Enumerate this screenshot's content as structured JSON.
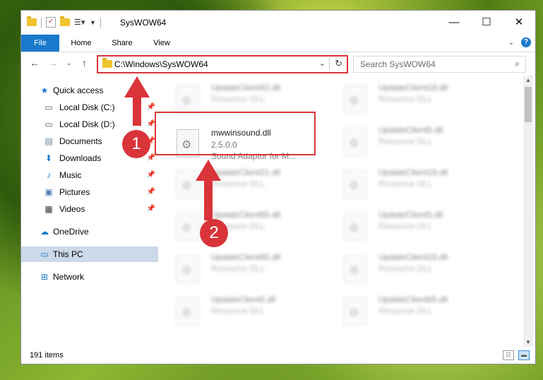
{
  "window": {
    "title": "SysWOW64"
  },
  "ribbon": {
    "tabs": [
      "File",
      "Home",
      "Share",
      "View"
    ]
  },
  "address": {
    "path": "C:\\Windows\\SysWOW64"
  },
  "search": {
    "placeholder": "Search SysWOW64"
  },
  "sidebar": {
    "items": [
      {
        "label": "Quick access",
        "icon": "star-icon"
      },
      {
        "label": "Local Disk (C:)",
        "icon": "drive-icon",
        "pinned": true
      },
      {
        "label": "Local Disk (D:)",
        "icon": "drive-icon",
        "pinned": true
      },
      {
        "label": "Documents",
        "icon": "documents-icon",
        "pinned": true
      },
      {
        "label": "Downloads",
        "icon": "download-icon",
        "pinned": true
      },
      {
        "label": "Music",
        "icon": "music-icon",
        "pinned": true
      },
      {
        "label": "Pictures",
        "icon": "pictures-icon",
        "pinned": true
      },
      {
        "label": "Videos",
        "icon": "videos-icon",
        "pinned": true
      },
      {
        "label": "OneDrive",
        "icon": "cloud-icon"
      },
      {
        "label": "This PC",
        "icon": "computer-icon",
        "selected": true
      },
      {
        "label": "Network",
        "icon": "network-icon"
      }
    ]
  },
  "files": {
    "left": [
      {
        "name": "UpdateClient42.dll",
        "desc": "Resource DLL"
      },
      {
        "name": "UpdateClient21.dll",
        "desc": "Resource DLL"
      },
      {
        "name": "UpdateClient65.dll",
        "desc": "Resource DLL"
      },
      {
        "name": "UpdateClient65.dll",
        "desc": "Resource DLL"
      },
      {
        "name": "UpdateClient5.dll",
        "desc": "Resource DLL"
      }
    ],
    "right": [
      {
        "name": "UpdateClient19.dll",
        "desc": "Resource DLL"
      },
      {
        "name": "UpdateClient5.dll",
        "desc": "Resource DLL"
      },
      {
        "name": "UpdateClient19.dll",
        "desc": "Resource DLL"
      },
      {
        "name": "UpdateClient5.dll",
        "desc": "Resource DLL"
      },
      {
        "name": "UpdateClient19.dll",
        "desc": "Resource DLL"
      },
      {
        "name": "UpdateClient65.dll",
        "desc": "Resource DLL"
      }
    ],
    "highlighted": {
      "name": "mwwinsound.dll",
      "version": "2.5.0.0",
      "desc": "Sound Adaptor for M..."
    }
  },
  "status": {
    "items": "191 items"
  },
  "annotations": {
    "step1": "1",
    "step2": "2",
    "color": "#d9343a"
  }
}
